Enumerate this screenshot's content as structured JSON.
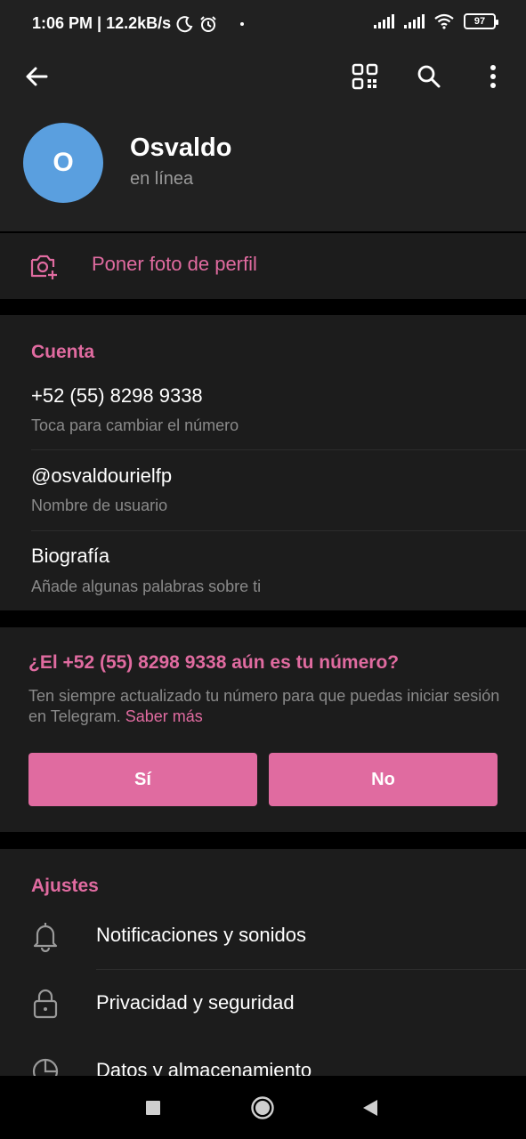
{
  "status_bar": {
    "time_speed": "1:06 PM | 12.2kB/s",
    "battery": "97"
  },
  "toolbar": {
    "back_icon": "arrow-left-icon",
    "qr_icon": "qr-code-icon",
    "search_icon": "search-icon",
    "menu_icon": "more-vertical-icon"
  },
  "profile": {
    "avatar_letter": "O",
    "avatar_color": "#5a9fdf",
    "name": "Osvaldo",
    "status": "en línea"
  },
  "set_photo": {
    "label": "Poner foto de perfil",
    "icon": "camera-add-icon"
  },
  "account": {
    "title": "Cuenta",
    "phone": "+52 (55) 8298 9338",
    "phone_hint": "Toca para cambiar el número",
    "username": "@osvaldourielfp",
    "username_hint": "Nombre de usuario",
    "bio": "Biografía",
    "bio_hint": "Añade algunas palabras sobre ti"
  },
  "suggestion": {
    "title": "¿El +52 (55) 8298 9338 aún es tu número?",
    "text": "Ten siempre actualizado tu número para que puedas iniciar sesión en Telegram.",
    "link": "Saber más",
    "yes_label": "Sí",
    "no_label": "No"
  },
  "settings": {
    "title": "Ajustes",
    "items": [
      {
        "label": "Notificaciones y sonidos",
        "icon": "bell-icon"
      },
      {
        "label": "Privacidad y seguridad",
        "icon": "lock-icon"
      },
      {
        "label": "Datos y almacenamiento",
        "icon": "pie-chart-icon"
      }
    ]
  },
  "colors": {
    "accent": "#e06ba0",
    "header_bg": "#212121",
    "section_bg": "#1c1c1c"
  }
}
